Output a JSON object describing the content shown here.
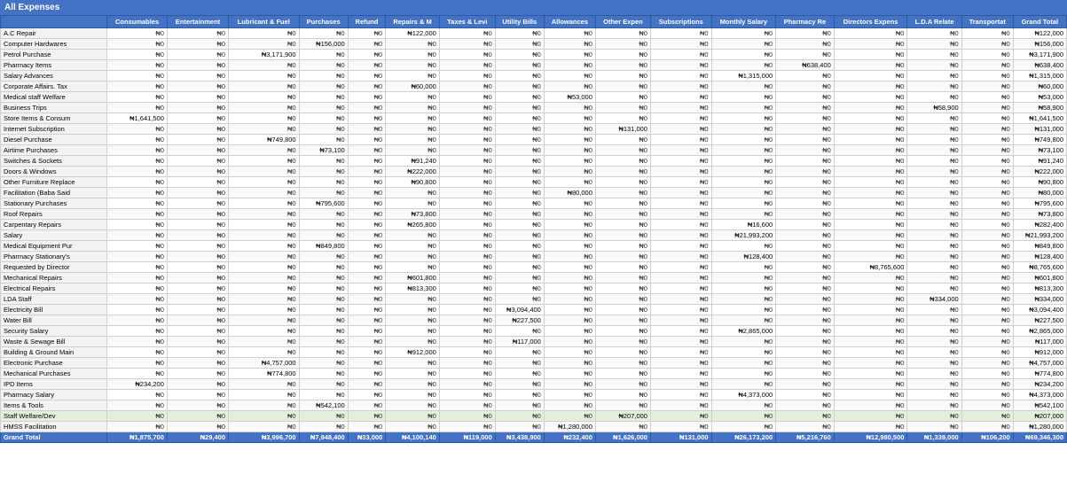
{
  "title": "All Expenses",
  "columns": [
    "Consumables",
    "Entertainment",
    "Lubricant & Fuel",
    "Purchases",
    "Refund",
    "Repairs & M",
    "Taxes & Levi",
    "Utility Bills",
    "Allowances",
    "Other Expen",
    "Subscriptions",
    "Monthly Salary",
    "Pharmacy Re",
    "Directors Expens",
    "L.D.A Relate",
    "Transportat",
    "Grand Total"
  ],
  "rows": [
    {
      "label": "A.C Repair",
      "values": [
        "₦0",
        "₦0",
        "₦0",
        "₦0",
        "₦0",
        "₦122,000",
        "₦0",
        "₦0",
        "₦0",
        "₦0",
        "₦0",
        "₦0",
        "₦0",
        "₦0",
        "₦0",
        "₦0",
        "₦122,000"
      ],
      "highlight": false
    },
    {
      "label": "Computer Hardwares",
      "values": [
        "₦0",
        "₦0",
        "₦0",
        "₦156,000",
        "₦0",
        "₦0",
        "₦0",
        "₦0",
        "₦0",
        "₦0",
        "₦0",
        "₦0",
        "₦0",
        "₦0",
        "₦0",
        "₦0",
        "₦156,000"
      ],
      "highlight": false
    },
    {
      "label": "Petrol Purchase",
      "values": [
        "₦0",
        "₦0",
        "₦3,171,900",
        "₦0",
        "₦0",
        "₦0",
        "₦0",
        "₦0",
        "₦0",
        "₦0",
        "₦0",
        "₦0",
        "₦0",
        "₦0",
        "₦0",
        "₦0",
        "₦3,171,900"
      ],
      "highlight": false
    },
    {
      "label": "Pharmacy Items",
      "values": [
        "₦0",
        "₦0",
        "₦0",
        "₦0",
        "₦0",
        "₦0",
        "₦0",
        "₦0",
        "₦0",
        "₦0",
        "₦0",
        "₦0",
        "₦638,400",
        "₦0",
        "₦0",
        "₦0",
        "₦638,400"
      ],
      "highlight": false
    },
    {
      "label": "Salary Advances",
      "values": [
        "₦0",
        "₦0",
        "₦0",
        "₦0",
        "₦0",
        "₦0",
        "₦0",
        "₦0",
        "₦0",
        "₦0",
        "₦0",
        "₦1,315,000",
        "₦0",
        "₦0",
        "₦0",
        "₦0",
        "₦1,315,000"
      ],
      "highlight": false
    },
    {
      "label": "Corporate Affairs. Tax",
      "values": [
        "₦0",
        "₦0",
        "₦0",
        "₦0",
        "₦0",
        "₦60,000",
        "₦0",
        "₦0",
        "₦0",
        "₦0",
        "₦0",
        "₦0",
        "₦0",
        "₦0",
        "₦0",
        "₦0",
        "₦60,000"
      ],
      "highlight": false
    },
    {
      "label": "Medical staff Welfare",
      "values": [
        "₦0",
        "₦0",
        "₦0",
        "₦0",
        "₦0",
        "₦0",
        "₦0",
        "₦0",
        "₦53,000",
        "₦0",
        "₦0",
        "₦0",
        "₦0",
        "₦0",
        "₦0",
        "₦0",
        "₦53,000"
      ],
      "highlight": false
    },
    {
      "label": "Business Trips",
      "values": [
        "₦0",
        "₦0",
        "₦0",
        "₦0",
        "₦0",
        "₦0",
        "₦0",
        "₦0",
        "₦0",
        "₦0",
        "₦0",
        "₦0",
        "₦0",
        "₦0",
        "₦58,900",
        "₦0",
        "₦58,900"
      ],
      "highlight": false
    },
    {
      "label": "Store Items & Consum",
      "values": [
        "₦1,641,500",
        "₦0",
        "₦0",
        "₦0",
        "₦0",
        "₦0",
        "₦0",
        "₦0",
        "₦0",
        "₦0",
        "₦0",
        "₦0",
        "₦0",
        "₦0",
        "₦0",
        "₦0",
        "₦1,641,500"
      ],
      "highlight": false
    },
    {
      "label": "Internet Subscription",
      "values": [
        "₦0",
        "₦0",
        "₦0",
        "₦0",
        "₦0",
        "₦0",
        "₦0",
        "₦0",
        "₦0",
        "₦131,000",
        "₦0",
        "₦0",
        "₦0",
        "₦0",
        "₦0",
        "₦0",
        "₦131,000"
      ],
      "highlight": false
    },
    {
      "label": "Diesel Purchase",
      "values": [
        "₦0",
        "₦0",
        "₦749,800",
        "₦0",
        "₦0",
        "₦0",
        "₦0",
        "₦0",
        "₦0",
        "₦0",
        "₦0",
        "₦0",
        "₦0",
        "₦0",
        "₦0",
        "₦0",
        "₦749,800"
      ],
      "highlight": false
    },
    {
      "label": "Airtime Purchases",
      "values": [
        "₦0",
        "₦0",
        "₦0",
        "₦73,100",
        "₦0",
        "₦0",
        "₦0",
        "₦0",
        "₦0",
        "₦0",
        "₦0",
        "₦0",
        "₦0",
        "₦0",
        "₦0",
        "₦0",
        "₦73,100"
      ],
      "highlight": false
    },
    {
      "label": "Switches & Sockets",
      "values": [
        "₦0",
        "₦0",
        "₦0",
        "₦0",
        "₦0",
        "₦91,240",
        "₦0",
        "₦0",
        "₦0",
        "₦0",
        "₦0",
        "₦0",
        "₦0",
        "₦0",
        "₦0",
        "₦0",
        "₦91,240"
      ],
      "highlight": false
    },
    {
      "label": "Doors & Windows",
      "values": [
        "₦0",
        "₦0",
        "₦0",
        "₦0",
        "₦0",
        "₦222,000",
        "₦0",
        "₦0",
        "₦0",
        "₦0",
        "₦0",
        "₦0",
        "₦0",
        "₦0",
        "₦0",
        "₦0",
        "₦222,000"
      ],
      "highlight": false
    },
    {
      "label": "Other Furniture Replace",
      "values": [
        "₦0",
        "₦0",
        "₦0",
        "₦0",
        "₦0",
        "₦90,800",
        "₦0",
        "₦0",
        "₦0",
        "₦0",
        "₦0",
        "₦0",
        "₦0",
        "₦0",
        "₦0",
        "₦0",
        "₦90,800"
      ],
      "highlight": false
    },
    {
      "label": "Facilitation (Baba Said",
      "values": [
        "₦0",
        "₦0",
        "₦0",
        "₦0",
        "₦0",
        "₦0",
        "₦0",
        "₦0",
        "₦80,000",
        "₦0",
        "₦0",
        "₦0",
        "₦0",
        "₦0",
        "₦0",
        "₦0",
        "₦80,000"
      ],
      "highlight": false
    },
    {
      "label": "Stationary Purchases",
      "values": [
        "₦0",
        "₦0",
        "₦0",
        "₦795,600",
        "₦0",
        "₦0",
        "₦0",
        "₦0",
        "₦0",
        "₦0",
        "₦0",
        "₦0",
        "₦0",
        "₦0",
        "₦0",
        "₦0",
        "₦795,600"
      ],
      "highlight": false
    },
    {
      "label": "Roof Repairs",
      "values": [
        "₦0",
        "₦0",
        "₦0",
        "₦0",
        "₦0",
        "₦73,800",
        "₦0",
        "₦0",
        "₦0",
        "₦0",
        "₦0",
        "₦0",
        "₦0",
        "₦0",
        "₦0",
        "₦0",
        "₦73,800"
      ],
      "highlight": false
    },
    {
      "label": "Carpentary Repairs",
      "values": [
        "₦0",
        "₦0",
        "₦0",
        "₦0",
        "₦0",
        "₦265,800",
        "₦0",
        "₦0",
        "₦0",
        "₦0",
        "₦0",
        "₦16,600",
        "₦0",
        "₦0",
        "₦0",
        "₦0",
        "₦282,400"
      ],
      "highlight": false
    },
    {
      "label": "Salary",
      "values": [
        "₦0",
        "₦0",
        "₦0",
        "₦0",
        "₦0",
        "₦0",
        "₦0",
        "₦0",
        "₦0",
        "₦0",
        "₦0",
        "₦21,993,200",
        "₦0",
        "₦0",
        "₦0",
        "₦0",
        "₦21,993,200"
      ],
      "highlight": false
    },
    {
      "label": "Medical Equipment Pur",
      "values": [
        "₦0",
        "₦0",
        "₦0",
        "₦849,800",
        "₦0",
        "₦0",
        "₦0",
        "₦0",
        "₦0",
        "₦0",
        "₦0",
        "₦0",
        "₦0",
        "₦0",
        "₦0",
        "₦0",
        "₦849,800"
      ],
      "highlight": false
    },
    {
      "label": "Pharmacy Stationary's",
      "values": [
        "₦0",
        "₦0",
        "₦0",
        "₦0",
        "₦0",
        "₦0",
        "₦0",
        "₦0",
        "₦0",
        "₦0",
        "₦0",
        "₦128,400",
        "₦0",
        "₦0",
        "₦0",
        "₦0",
        "₦128,400"
      ],
      "highlight": false
    },
    {
      "label": "Requested by Director",
      "values": [
        "₦0",
        "₦0",
        "₦0",
        "₦0",
        "₦0",
        "₦0",
        "₦0",
        "₦0",
        "₦0",
        "₦0",
        "₦0",
        "₦0",
        "₦0",
        "₦8,765,600",
        "₦0",
        "₦0",
        "₦8,765,600"
      ],
      "highlight": false
    },
    {
      "label": "Mechanical Repairs",
      "values": [
        "₦0",
        "₦0",
        "₦0",
        "₦0",
        "₦0",
        "₦601,800",
        "₦0",
        "₦0",
        "₦0",
        "₦0",
        "₦0",
        "₦0",
        "₦0",
        "₦0",
        "₦0",
        "₦0",
        "₦601,800"
      ],
      "highlight": false
    },
    {
      "label": "Electrical Repairs",
      "values": [
        "₦0",
        "₦0",
        "₦0",
        "₦0",
        "₦0",
        "₦813,300",
        "₦0",
        "₦0",
        "₦0",
        "₦0",
        "₦0",
        "₦0",
        "₦0",
        "₦0",
        "₦0",
        "₦0",
        "₦813,300"
      ],
      "highlight": false
    },
    {
      "label": "LDA Staff",
      "values": [
        "₦0",
        "₦0",
        "₦0",
        "₦0",
        "₦0",
        "₦0",
        "₦0",
        "₦0",
        "₦0",
        "₦0",
        "₦0",
        "₦0",
        "₦0",
        "₦0",
        "₦334,000",
        "₦0",
        "₦334,000"
      ],
      "highlight": false
    },
    {
      "label": "Electricity Bill",
      "values": [
        "₦0",
        "₦0",
        "₦0",
        "₦0",
        "₦0",
        "₦0",
        "₦0",
        "₦3,094,400",
        "₦0",
        "₦0",
        "₦0",
        "₦0",
        "₦0",
        "₦0",
        "₦0",
        "₦0",
        "₦3,094,400"
      ],
      "highlight": false
    },
    {
      "label": "Water Bill",
      "values": [
        "₦0",
        "₦0",
        "₦0",
        "₦0",
        "₦0",
        "₦0",
        "₦0",
        "₦227,500",
        "₦0",
        "₦0",
        "₦0",
        "₦0",
        "₦0",
        "₦0",
        "₦0",
        "₦0",
        "₦227,500"
      ],
      "highlight": false
    },
    {
      "label": "Security Salary",
      "values": [
        "₦0",
        "₦0",
        "₦0",
        "₦0",
        "₦0",
        "₦0",
        "₦0",
        "₦0",
        "₦0",
        "₦0",
        "₦0",
        "₦2,865,000",
        "₦0",
        "₦0",
        "₦0",
        "₦0",
        "₦2,865,000"
      ],
      "highlight": false
    },
    {
      "label": "Waste & Sewage Bill",
      "values": [
        "₦0",
        "₦0",
        "₦0",
        "₦0",
        "₦0",
        "₦0",
        "₦0",
        "₦117,000",
        "₦0",
        "₦0",
        "₦0",
        "₦0",
        "₦0",
        "₦0",
        "₦0",
        "₦0",
        "₦117,000"
      ],
      "highlight": false
    },
    {
      "label": "Building & Ground Main",
      "values": [
        "₦0",
        "₦0",
        "₦0",
        "₦0",
        "₦0",
        "₦912,000",
        "₦0",
        "₦0",
        "₦0",
        "₦0",
        "₦0",
        "₦0",
        "₦0",
        "₦0",
        "₦0",
        "₦0",
        "₦912,000"
      ],
      "highlight": false
    },
    {
      "label": "Electronic Purchase",
      "values": [
        "₦0",
        "₦0",
        "₦4,757,000",
        "₦0",
        "₦0",
        "₦0",
        "₦0",
        "₦0",
        "₦0",
        "₦0",
        "₦0",
        "₦0",
        "₦0",
        "₦0",
        "₦0",
        "₦0",
        "₦4,757,000"
      ],
      "highlight": false
    },
    {
      "label": "Mechanical Purchases",
      "values": [
        "₦0",
        "₦0",
        "₦774,800",
        "₦0",
        "₦0",
        "₦0",
        "₦0",
        "₦0",
        "₦0",
        "₦0",
        "₦0",
        "₦0",
        "₦0",
        "₦0",
        "₦0",
        "₦0",
        "₦774,800"
      ],
      "highlight": false
    },
    {
      "label": "IPD Items",
      "values": [
        "₦234,200",
        "₦0",
        "₦0",
        "₦0",
        "₦0",
        "₦0",
        "₦0",
        "₦0",
        "₦0",
        "₦0",
        "₦0",
        "₦0",
        "₦0",
        "₦0",
        "₦0",
        "₦0",
        "₦234,200"
      ],
      "highlight": false
    },
    {
      "label": "Pharmacy Salary",
      "values": [
        "₦0",
        "₦0",
        "₦0",
        "₦0",
        "₦0",
        "₦0",
        "₦0",
        "₦0",
        "₦0",
        "₦0",
        "₦0",
        "₦4,373,000",
        "₦0",
        "₦0",
        "₦0",
        "₦0",
        "₦4,373,000"
      ],
      "highlight": false
    },
    {
      "label": "Items & Tools",
      "values": [
        "₦0",
        "₦0",
        "₦0",
        "₦542,100",
        "₦0",
        "₦0",
        "₦0",
        "₦0",
        "₦0",
        "₦0",
        "₦0",
        "₦0",
        "₦0",
        "₦0",
        "₦0",
        "₦0",
        "₦542,100"
      ],
      "highlight": false
    },
    {
      "label": "Staff Welfare/Dev",
      "values": [
        "₦0",
        "₦0",
        "₦0",
        "₦0",
        "₦0",
        "₦0",
        "₦0",
        "₦0",
        "₦0",
        "₦207,000",
        "₦0",
        "₦0",
        "₦0",
        "₦0",
        "₦0",
        "₦0",
        "₦207,000"
      ],
      "highlight": true
    },
    {
      "label": "HMSS Facilitation",
      "values": [
        "₦0",
        "₦0",
        "₦0",
        "₦0",
        "₦0",
        "₦0",
        "₦0",
        "₦0",
        "₦1,280,000",
        "₦0",
        "₦0",
        "₦0",
        "₦0",
        "₦0",
        "₦0",
        "₦0",
        "₦1,280,000"
      ],
      "highlight": false
    }
  ],
  "grand_total": {
    "label": "Grand Total",
    "values": [
      "₦1,875,700",
      "₦29,400",
      "₦3,996,700",
      "₦7,948,400",
      "₦33,000",
      "₦4,100,140",
      "₦119,000",
      "₦3,438,900",
      "₦232,400",
      "₦1,626,000",
      "₦131,000",
      "₦26,173,200",
      "₦5,216,760",
      "₦12,980,500",
      "₦1,339,000",
      "₦106,200",
      "₦69,346,300"
    ]
  }
}
